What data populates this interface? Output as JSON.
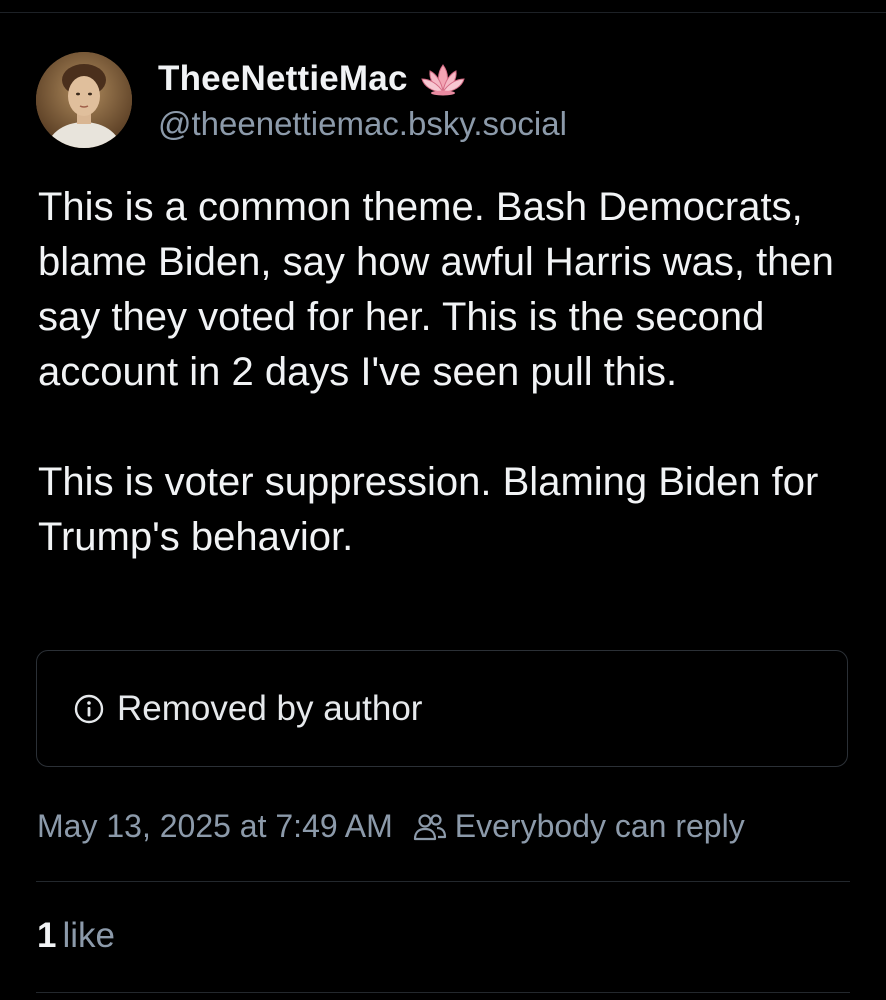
{
  "post": {
    "author": {
      "display_name": "TheeNettieMac",
      "display_emoji": "lotus-icon",
      "handle": "@theenettiemac.bsky.social"
    },
    "text": "This is a common theme. Bash Democrats, blame Biden, say how awful Harris was, then say they voted for her. This is the second account in 2 days I've seen pull this.\n\nThis is voter suppression. Blaming Biden for Trump's behavior.",
    "embed": {
      "status_text": "Removed by author",
      "icon": "info-icon"
    },
    "timestamp": "May 13, 2025 at 7:49 AM",
    "reply_setting": "Everybody can reply",
    "reply_icon": "people-icon",
    "likes": {
      "count": "1",
      "label": "like"
    }
  },
  "colors": {
    "background": "#000000",
    "primary_text": "#f1f3f5",
    "secondary_text": "#8c9aaa",
    "border": "#2b3036"
  }
}
